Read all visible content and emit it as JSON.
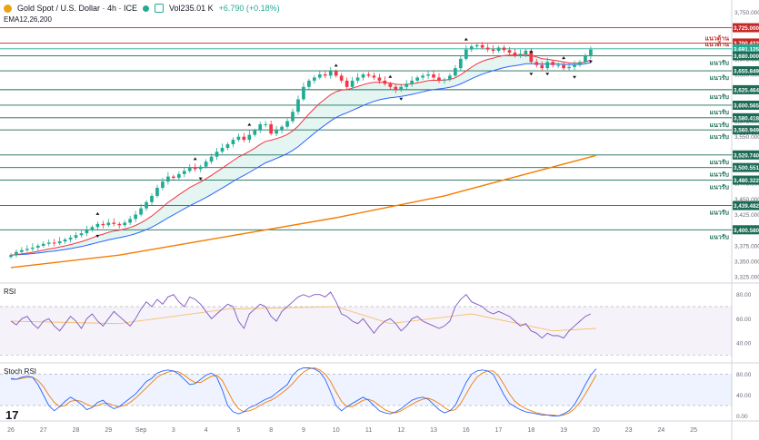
{
  "header": {
    "symbol": "Gold Spot / U.S. Dollar · 4h · ICE",
    "volume": "Vol235.01 K",
    "change": "+6.790 (+0.18%)",
    "ema_label": "EMA12,26,200"
  },
  "colors": {
    "up": "#22ab94",
    "down": "#f23645",
    "ema_fast": "#f23645",
    "ema_slow": "#2962ff",
    "ema_200": "#f57c00",
    "support_line": "#1b6b55",
    "resistance_line": "#c62828",
    "rsi_line": "#7e57c2",
    "rsi_ma": "#f5c16c",
    "stoch_k": "#2962ff",
    "stoch_d": "#f57c00"
  },
  "chart_data": [
    {
      "type": "candlestick",
      "y_axis_ticks": [
        "3,750.000",
        "3,725.000",
        "3,700.000",
        "3,675.000",
        "3,650.000",
        "3,625.000",
        "3,600.000",
        "3,575.000",
        "3,550.000",
        "3,525.000",
        "3,500.000",
        "3,475.000",
        "3,450.000",
        "3,425.000",
        "3,400.000",
        "3,375.000",
        "3,350.000",
        "3,325.000"
      ],
      "ylim": [
        3318,
        3752
      ],
      "x_axis_ticks": [
        {
          "label": "26",
          "t": 0
        },
        {
          "label": "27",
          "t": 6
        },
        {
          "label": "28",
          "t": 12
        },
        {
          "label": "29",
          "t": 18
        },
        {
          "label": "Sep",
          "t": 24
        },
        {
          "label": "3",
          "t": 30
        },
        {
          "label": "4",
          "t": 36
        },
        {
          "label": "5",
          "t": 42
        },
        {
          "label": "8",
          "t": 48
        },
        {
          "label": "9",
          "t": 54
        },
        {
          "label": "10",
          "t": 60
        },
        {
          "label": "11",
          "t": 66
        },
        {
          "label": "12",
          "t": 72
        },
        {
          "label": "13",
          "t": 78
        },
        {
          "label": "16",
          "t": 84
        },
        {
          "label": "17",
          "t": 90
        },
        {
          "label": "18",
          "t": 96
        },
        {
          "label": "19",
          "t": 102
        },
        {
          "label": "20",
          "t": 108
        },
        {
          "label": "23",
          "t": 114
        },
        {
          "label": "24",
          "t": 120
        },
        {
          "label": "25",
          "t": 126
        }
      ],
      "levels": [
        {
          "value": 3725.0,
          "label": "3,725.000",
          "zone": "",
          "kind": "resistance"
        },
        {
          "value": 3700.422,
          "label": "3,700.422",
          "zone": "แนวต้าน",
          "kind": "resistance"
        },
        {
          "value": 3691.125,
          "label": "3,691.125",
          "zone": "แนวต้าน",
          "kind": "current"
        },
        {
          "value": 3680.0,
          "label": "3,680.000",
          "zone": "แนวรับ",
          "kind": "support"
        },
        {
          "value": 3655.849,
          "label": "3,655.849",
          "zone": "แนวรับ",
          "kind": "support"
        },
        {
          "value": 3625.464,
          "label": "3,625.464",
          "zone": "แนวรับ",
          "kind": "support"
        },
        {
          "value": 3600.565,
          "label": "3,600.565",
          "zone": "แนวรับ",
          "kind": "support"
        },
        {
          "value": 3580.418,
          "label": "3,580.418",
          "zone": "แนวรับ",
          "kind": "support"
        },
        {
          "value": 3560.949,
          "label": "3,560.949",
          "zone": "แนวรับ",
          "kind": "support"
        },
        {
          "value": 3520.74,
          "label": "3,520.740",
          "zone": "แนวรับ",
          "kind": "support"
        },
        {
          "value": 3500.551,
          "label": "3,500.551",
          "zone": "แนวรับ",
          "kind": "support"
        },
        {
          "value": 3480.322,
          "label": "3,480.322",
          "zone": "แนวรับ",
          "kind": "support"
        },
        {
          "value": 3439.482,
          "label": "3,439.482",
          "zone": "แนวรับ",
          "kind": "support"
        },
        {
          "value": 3400.58,
          "label": "3,400.580",
          "zone": "แนวรับ",
          "kind": "support"
        }
      ],
      "closes": [
        3360,
        3365,
        3368,
        3370,
        3372,
        3375,
        3378,
        3380,
        3379,
        3382,
        3385,
        3388,
        3392,
        3395,
        3400,
        3405,
        3410,
        3408,
        3412,
        3410,
        3408,
        3412,
        3418,
        3425,
        3435,
        3445,
        3455,
        3468,
        3478,
        3486,
        3484,
        3490,
        3495,
        3500,
        3498,
        3502,
        3510,
        3518,
        3526,
        3532,
        3538,
        3545,
        3550,
        3545,
        3553,
        3560,
        3570,
        3570,
        3555,
        3560,
        3566,
        3575,
        3590,
        3610,
        3630,
        3640,
        3645,
        3650,
        3648,
        3655,
        3648,
        3640,
        3630,
        3640,
        3645,
        3650,
        3648,
        3645,
        3640,
        3635,
        3630,
        3625,
        3630,
        3635,
        3640,
        3645,
        3648,
        3650,
        3645,
        3640,
        3642,
        3648,
        3660,
        3675,
        3690,
        3695,
        3697,
        3693,
        3690,
        3688,
        3693,
        3689,
        3685,
        3680,
        3683,
        3688,
        3670,
        3665,
        3660,
        3670,
        3665,
        3665,
        3660,
        3662,
        3665,
        3670,
        3680,
        3690
      ],
      "ema200": [
        [
          0,
          3340
        ],
        [
          20,
          3360
        ],
        [
          40,
          3390
        ],
        [
          60,
          3420
        ],
        [
          80,
          3455
        ],
        [
          95,
          3490
        ],
        [
          108,
          3520
        ]
      ],
      "markers_up_t": [
        16,
        34,
        44,
        60,
        70,
        84,
        96,
        102
      ],
      "markers_down_t": [
        16,
        35,
        72,
        96,
        99,
        104,
        107
      ]
    },
    {
      "type": "line",
      "title": "RSI",
      "y_axis_ticks": [
        "80.00",
        "60.00",
        "40.00"
      ],
      "ylim": [
        25,
        88
      ],
      "band": [
        30,
        70
      ],
      "rsi": [
        58,
        55,
        60,
        62,
        56,
        52,
        58,
        60,
        54,
        50,
        56,
        62,
        58,
        52,
        60,
        64,
        58,
        54,
        60,
        66,
        62,
        58,
        54,
        60,
        68,
        74,
        70,
        76,
        72,
        78,
        80,
        74,
        70,
        78,
        76,
        72,
        66,
        60,
        64,
        68,
        72,
        70,
        58,
        52,
        64,
        68,
        72,
        70,
        62,
        58,
        66,
        70,
        74,
        78,
        80,
        78,
        80,
        80,
        78,
        82,
        74,
        64,
        62,
        58,
        56,
        60,
        54,
        48,
        54,
        58,
        60,
        56,
        50,
        54,
        60,
        62,
        58,
        56,
        54,
        52,
        54,
        58,
        70,
        76,
        80,
        74,
        72,
        70,
        66,
        64,
        66,
        64,
        62,
        58,
        54,
        56,
        50,
        48,
        44,
        48,
        46,
        46,
        44,
        50,
        54,
        58,
        62,
        64
      ],
      "rsi_ma": [
        [
          0,
          58
        ],
        [
          20,
          56
        ],
        [
          40,
          68
        ],
        [
          60,
          70
        ],
        [
          70,
          56
        ],
        [
          85,
          64
        ],
        [
          100,
          50
        ],
        [
          108,
          52
        ]
      ]
    },
    {
      "type": "line",
      "title": "Stoch RSI",
      "y_axis_ticks": [
        "80.00",
        "40.00",
        "0.00"
      ],
      "ylim": [
        -6,
        98
      ],
      "band": [
        20,
        80
      ],
      "k": [
        72,
        70,
        74,
        76,
        74,
        60,
        40,
        20,
        10,
        18,
        28,
        36,
        30,
        22,
        12,
        16,
        26,
        30,
        20,
        14,
        18,
        26,
        34,
        42,
        54,
        66,
        72,
        82,
        86,
        88,
        86,
        80,
        70,
        60,
        62,
        70,
        78,
        82,
        74,
        50,
        20,
        8,
        4,
        8,
        16,
        20,
        26,
        32,
        36,
        44,
        52,
        60,
        78,
        88,
        92,
        92,
        90,
        84,
        70,
        46,
        20,
        10,
        18,
        24,
        30,
        36,
        30,
        20,
        10,
        6,
        4,
        8,
        14,
        22,
        30,
        34,
        36,
        32,
        22,
        12,
        6,
        10,
        20,
        42,
        64,
        80,
        86,
        88,
        86,
        80,
        60,
        40,
        24,
        18,
        12,
        8,
        6,
        4,
        2,
        2,
        0,
        0,
        4,
        10,
        22,
        40,
        60,
        78,
        90
      ],
      "d": [
        70,
        70,
        72,
        74,
        74,
        68,
        56,
        40,
        26,
        18,
        20,
        28,
        30,
        28,
        22,
        18,
        20,
        24,
        24,
        20,
        18,
        20,
        26,
        34,
        44,
        54,
        64,
        74,
        80,
        84,
        86,
        84,
        78,
        70,
        64,
        64,
        70,
        76,
        78,
        68,
        48,
        28,
        14,
        8,
        10,
        14,
        20,
        26,
        30,
        36,
        44,
        52,
        62,
        74,
        84,
        90,
        92,
        88,
        80,
        66,
        46,
        28,
        18,
        18,
        24,
        30,
        32,
        28,
        20,
        12,
        8,
        6,
        10,
        16,
        22,
        28,
        32,
        34,
        30,
        24,
        16,
        10,
        12,
        24,
        42,
        60,
        74,
        82,
        86,
        86,
        76,
        60,
        42,
        28,
        20,
        14,
        10,
        6,
        4,
        2,
        2,
        0,
        2,
        6,
        14,
        26,
        42,
        60,
        78
      ]
    }
  ]
}
